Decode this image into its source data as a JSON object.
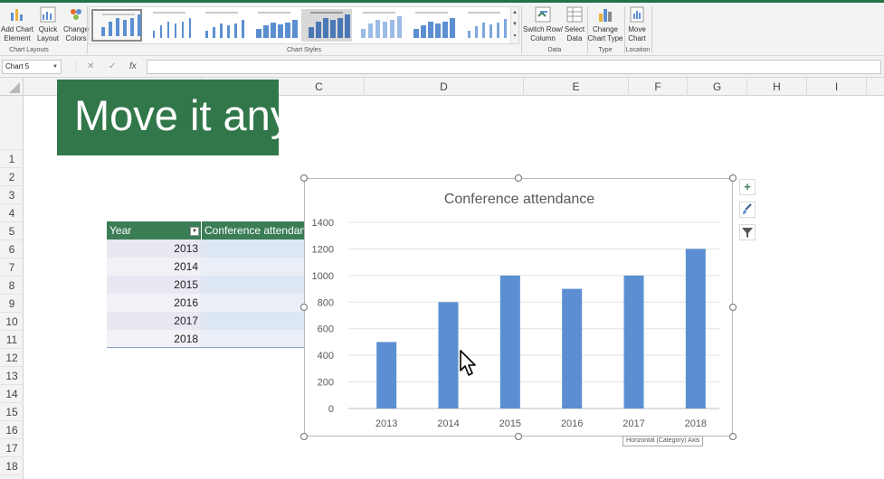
{
  "ribbon": {
    "add_chart_element": [
      "Add Chart",
      "Element"
    ],
    "quick_layout": [
      "Quick",
      "Layout"
    ],
    "change_colors": [
      "Change",
      "Colors"
    ],
    "switch_row_column": [
      "Switch Row/",
      "Column"
    ],
    "select_data": [
      "Select",
      "Data"
    ],
    "change_chart_type": [
      "Change",
      "Chart Type"
    ],
    "move_chart": [
      "Move",
      "Chart"
    ],
    "group_labels": {
      "chart_layouts": "Chart Layouts",
      "chart_styles": "Chart Styles",
      "data": "Data",
      "type": "Type",
      "location": "Location"
    }
  },
  "formula_bar": {
    "name_box": "Chart 5",
    "cancel": "✕",
    "enter": "✓",
    "fx": "fx",
    "value": ""
  },
  "columns": [
    "C",
    "D",
    "E",
    "F",
    "G",
    "H",
    "I"
  ],
  "rows": [
    "1",
    "2",
    "3",
    "4",
    "5",
    "6",
    "7",
    "8",
    "9",
    "10",
    "11",
    "12",
    "13",
    "14",
    "15",
    "16",
    "17",
    "18"
  ],
  "banner": {
    "text": "Move it any"
  },
  "table": {
    "headers": [
      "Year",
      "Conference attendance"
    ],
    "rows": [
      {
        "year": "2013"
      },
      {
        "year": "2014"
      },
      {
        "year": "2015"
      },
      {
        "year": "2016"
      },
      {
        "year": "2017"
      },
      {
        "year": "2018"
      }
    ]
  },
  "colors": {
    "excel_green": "#217346",
    "table_header": "#3b7d55",
    "bar": "#5b8fd1",
    "row_band_a": "#e8e8f2",
    "row_band_b": "#f1f1f6",
    "row_band_c": "#dde6f3"
  },
  "chart_data": {
    "type": "bar",
    "title": "Conference attendance",
    "categories": [
      "2013",
      "2014",
      "2015",
      "2016",
      "2017",
      "2018"
    ],
    "values": [
      500,
      800,
      1000,
      900,
      1000,
      1200
    ],
    "ylim": [
      0,
      1400
    ],
    "yticks": [
      0,
      200,
      400,
      600,
      800,
      1000,
      1200,
      1400
    ],
    "grid": true,
    "legend": "none",
    "xlabel": "",
    "ylabel": ""
  },
  "side_buttons": {
    "chart_elements": "+",
    "chart_styles": "brush-icon",
    "chart_filters": "funnel-icon"
  },
  "tooltip": "Horizontal (Category) Axis"
}
